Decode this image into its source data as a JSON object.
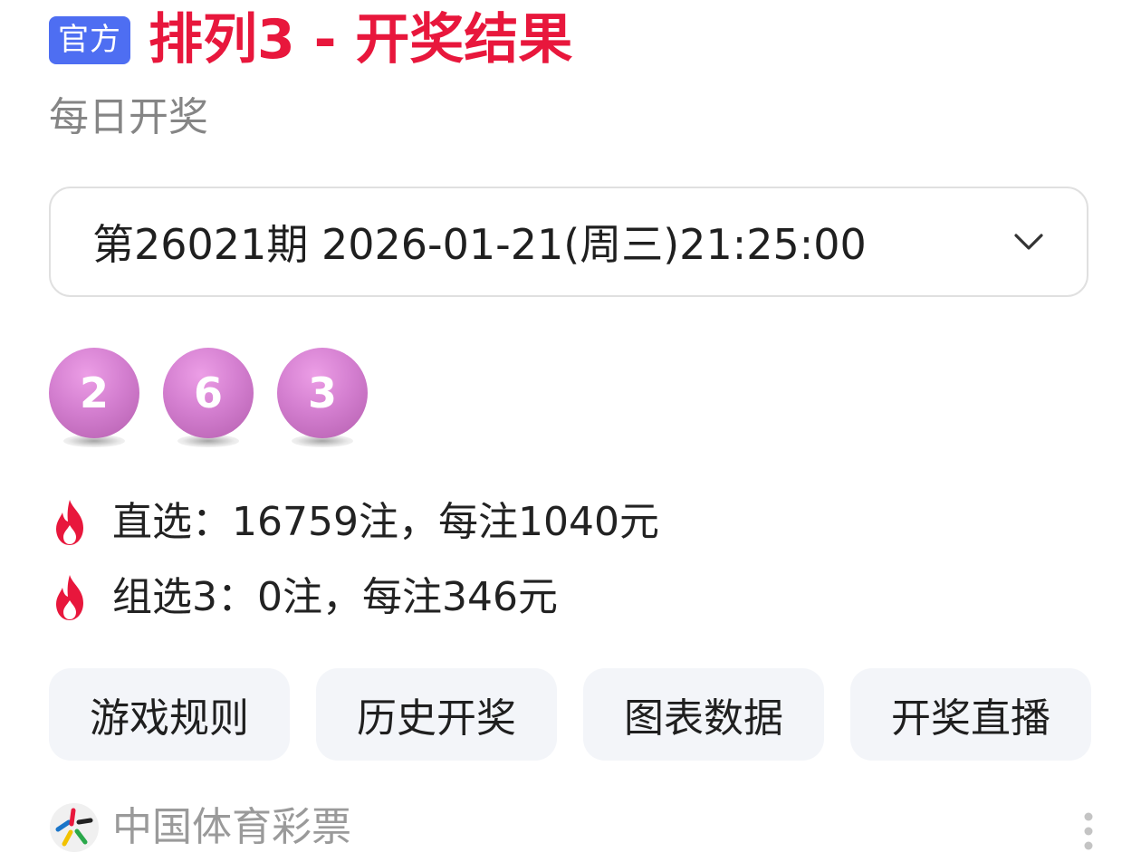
{
  "header": {
    "badge": "官方",
    "title": "排列3 - 开奖结果",
    "subtitle": "每日开奖"
  },
  "issue_select": {
    "selected": "第26021期 2026-01-21(周三)21:25:00"
  },
  "balls": [
    "2",
    "6",
    "3"
  ],
  "prizes": [
    {
      "text": "直选：16759注，每注1040元"
    },
    {
      "text": "组选3：0注，每注346元"
    }
  ],
  "actions": [
    {
      "label": "游戏规则"
    },
    {
      "label": "历史开奖"
    },
    {
      "label": "图表数据"
    },
    {
      "label": "开奖直播"
    }
  ],
  "footer": {
    "source": "中国体育彩票"
  },
  "colors": {
    "title": "#e8173c",
    "badge": "#4e6ef2",
    "ball": "#d47fd0",
    "fire": "#e8173c"
  }
}
